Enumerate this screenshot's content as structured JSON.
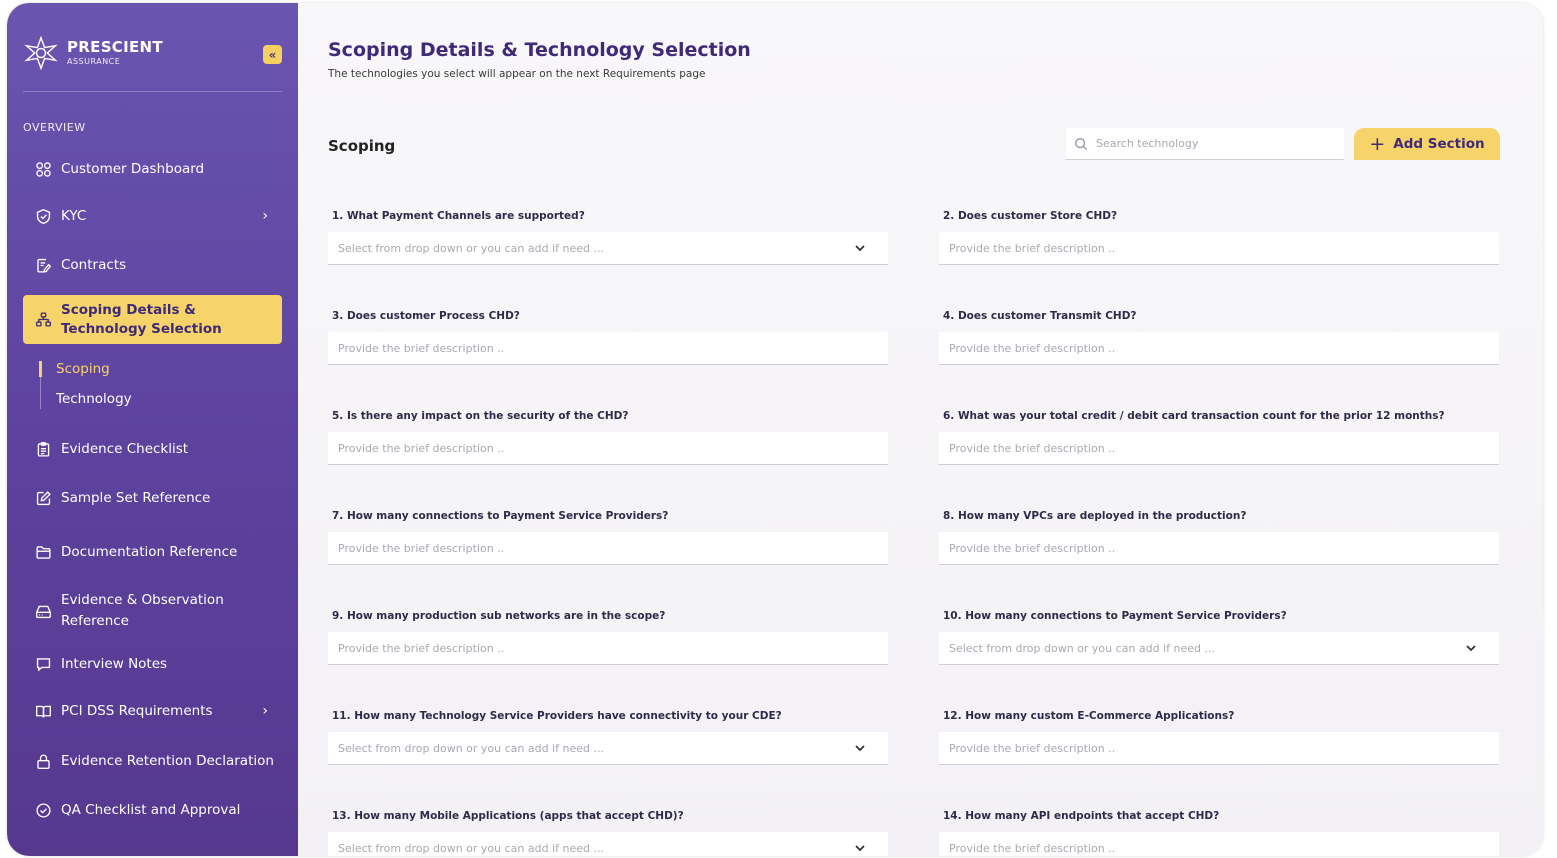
{
  "brand": {
    "name": "PRESCIENT",
    "sub": "ASSURANCE"
  },
  "sidebar": {
    "collapse_icon": "«",
    "overview_label": "OVERVIEW",
    "items": [
      {
        "label": "Customer Dashboard",
        "icon": "grid-icon"
      },
      {
        "label": "KYC",
        "icon": "shield-icon",
        "chevron": "›"
      },
      {
        "label": "Contracts",
        "icon": "document-edit-icon"
      },
      {
        "label": "Scoping Details & Technology Selection",
        "line1": "Scoping Details &",
        "line2": "Technology Selection",
        "icon": "hierarchy-icon"
      },
      {
        "label": "Evidence Checklist",
        "icon": "clipboard-icon"
      },
      {
        "label": "Sample Set Reference",
        "icon": "edit-box-icon"
      },
      {
        "label": "Documentation Reference",
        "icon": "folder-icon"
      },
      {
        "label": "Evidence & Observation Reference",
        "line1": "Evidence & Observation",
        "line2": "Reference",
        "icon": "drive-icon"
      },
      {
        "label": "Interview Notes",
        "icon": "chat-icon"
      },
      {
        "label": "PCI DSS Requirements",
        "icon": "book-icon",
        "chevron": "›"
      },
      {
        "label": "Evidence Retention Declaration",
        "icon": "lock-icon"
      },
      {
        "label": "QA Checklist and Approval",
        "icon": "check-circle-icon"
      }
    ],
    "sub_items": [
      {
        "label": "Scoping"
      },
      {
        "label": "Technology"
      }
    ]
  },
  "main": {
    "title": "Scoping Details & Technology Selection",
    "subtitle": "The technologies you select will appear on the next Requirements page",
    "section_title": "Scoping",
    "search_placeholder": "Search technology",
    "add_button": "Add Section",
    "add_icon": "+",
    "questions": [
      {
        "label": "1. What Payment Channels are supported?",
        "placeholder": "Select from drop down or you can add if need ...",
        "type": "select"
      },
      {
        "label": "2. Does customer Store CHD?",
        "placeholder": "Provide the brief description ..",
        "type": "text"
      },
      {
        "label": "3. Does customer Process CHD?",
        "placeholder": "Provide the brief description ..",
        "type": "text"
      },
      {
        "label": "4. Does customer Transmit CHD?",
        "placeholder": "Provide the brief description ..",
        "type": "text"
      },
      {
        "label": "5. Is there any impact on the security of the CHD?",
        "placeholder": "Provide the brief description ..",
        "type": "text"
      },
      {
        "label": "6. What was your total credit / debit card transaction count for the prior 12 months?",
        "placeholder": "Provide the brief description ..",
        "type": "text"
      },
      {
        "label": "7. How many connections to Payment Service Providers?",
        "placeholder": "Provide the brief description ..",
        "type": "text"
      },
      {
        "label": "8. How many VPCs are deployed in the production?",
        "placeholder": "Provide the brief description ..",
        "type": "text"
      },
      {
        "label": "9. How many production sub networks are in the scope?",
        "placeholder": "Provide the brief description ..",
        "type": "text"
      },
      {
        "label": "10. How many connections to Payment Service Providers?",
        "placeholder": "Select from drop down or you can add if need ...",
        "type": "select"
      },
      {
        "label": "11. How many Technology Service Providers have connectivity to your CDE?",
        "placeholder": "Select from drop down or you can add if need ...",
        "type": "select"
      },
      {
        "label": "12. How many custom E-Commerce Applications?",
        "placeholder": "Provide the brief description ..",
        "type": "text"
      },
      {
        "label": "13. How many Mobile Applications (apps that accept CHD)?",
        "placeholder": "Select from drop down or you can add if need ...",
        "type": "select"
      },
      {
        "label": "14. How many API endpoints that accept CHD?",
        "placeholder": "Provide the brief description ..",
        "type": "text"
      }
    ]
  }
}
